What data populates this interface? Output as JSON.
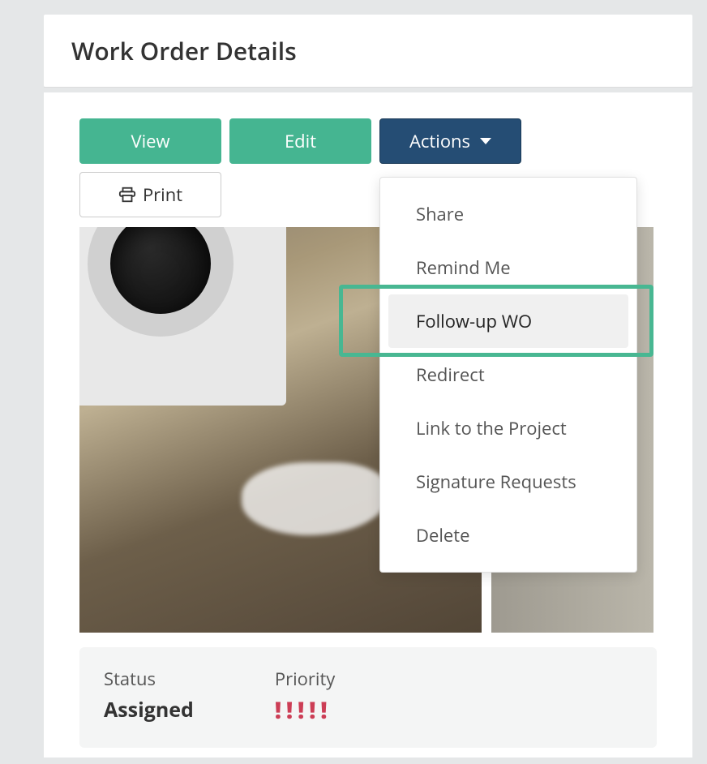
{
  "header": {
    "title": "Work Order Details"
  },
  "toolbar": {
    "view_label": "View",
    "edit_label": "Edit",
    "actions_label": "Actions",
    "print_label": "Print"
  },
  "actions_menu": {
    "items": [
      {
        "label": "Share"
      },
      {
        "label": "Remind Me"
      },
      {
        "label": "Follow-up WO"
      },
      {
        "label": "Redirect"
      },
      {
        "label": "Link to the Project"
      },
      {
        "label": "Signature Requests"
      },
      {
        "label": "Delete"
      }
    ],
    "highlighted_index": 2
  },
  "info": {
    "status_label": "Status",
    "status_value": "Assigned",
    "priority_label": "Priority",
    "priority_marks": "!!!!!"
  },
  "icons": {
    "printer": "printer-icon",
    "caret": "chevron-down-icon"
  },
  "colors": {
    "teal": "#45b591",
    "navy": "#254d74",
    "priority": "#cc3d55"
  }
}
